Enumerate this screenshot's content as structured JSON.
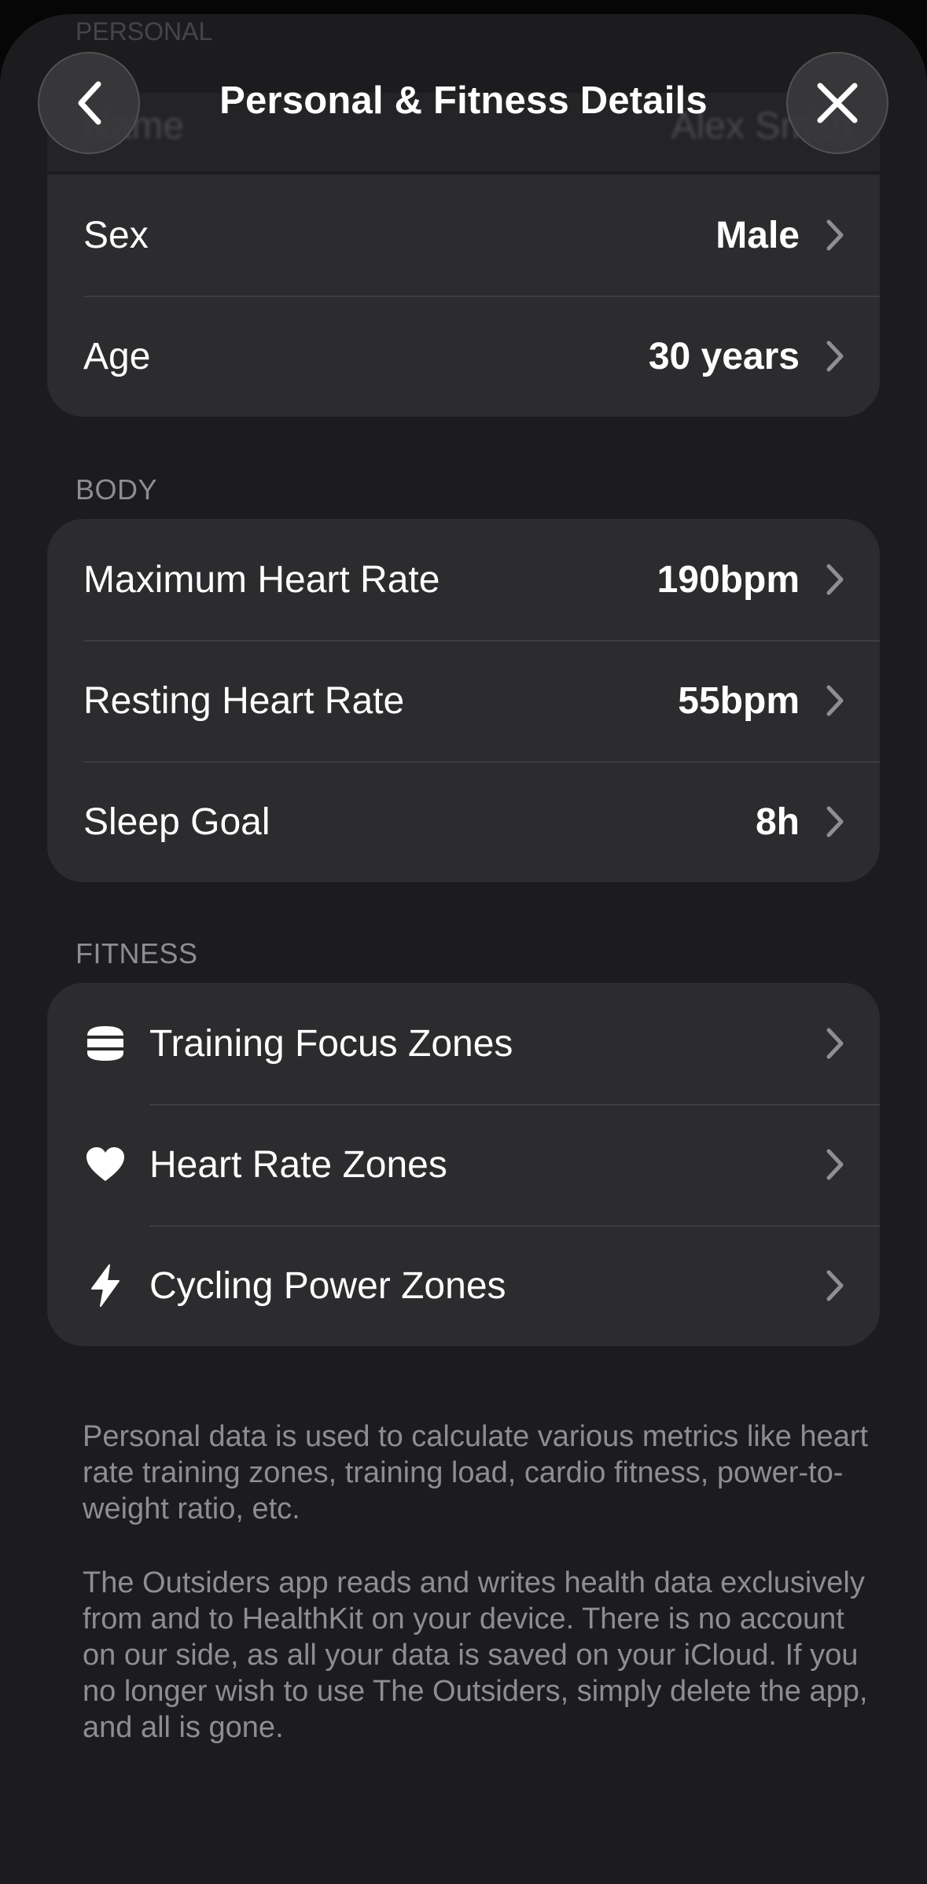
{
  "header": {
    "title": "Personal & Fitness Details",
    "ghost_section": "PERSONAL",
    "ghost_name_label": "Name",
    "ghost_name_value": "Alex Smith"
  },
  "personal": {
    "rows": [
      {
        "label": "Sex",
        "value": "Male"
      },
      {
        "label": "Age",
        "value": "30 years"
      }
    ]
  },
  "body": {
    "header": "BODY",
    "rows": [
      {
        "label": "Maximum Heart Rate",
        "value": "190bpm"
      },
      {
        "label": "Resting Heart Rate",
        "value": "55bpm"
      },
      {
        "label": "Sleep Goal",
        "value": "8h"
      }
    ]
  },
  "fitness": {
    "header": "FITNESS",
    "rows": [
      {
        "label": "Training Focus Zones",
        "icon": "stacked-layers-icon"
      },
      {
        "label": "Heart Rate Zones",
        "icon": "heart-icon"
      },
      {
        "label": "Cycling Power Zones",
        "icon": "bolt-icon"
      }
    ]
  },
  "footer": {
    "paragraph_1": "Personal data is used to calculate various metrics like heart rate training zones, training load, cardio fitness, power-to-weight ratio, etc.",
    "paragraph_2": "The Outsiders app reads and writes health data exclusively from and to HealthKit on your device. There is no account on our side, as all your data is saved on your iCloud. If you no longer wish to use The Outsiders, simply delete the app, and all is gone."
  },
  "colors": {
    "background": "#1c1c1e",
    "card": "#2c2c2e",
    "secondary_text": "#8d8d92",
    "chevron": "#8e8e93"
  }
}
